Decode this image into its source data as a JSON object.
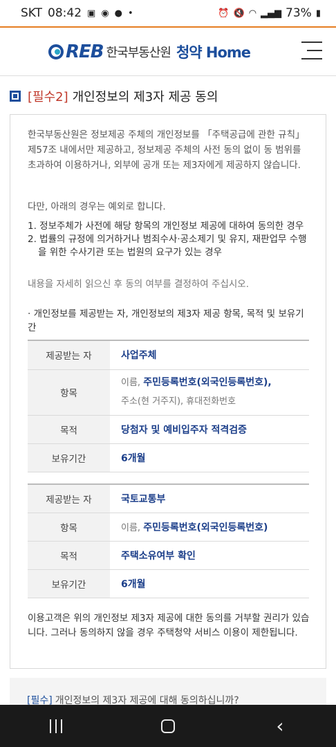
{
  "status_bar": {
    "carrier": "SKT",
    "time": "08:42",
    "battery": "73%"
  },
  "header": {
    "logo_reb": "REB",
    "logo_org": "한국부동산원",
    "logo_app_a": "청약",
    "logo_app_b": "Home"
  },
  "section": {
    "tag": "[필수2]",
    "title": "개인정보의 제3자 제공 동의"
  },
  "content": {
    "intro": "한국부동산원은 정보제공 주체의 개인정보를 「주택공급에 관한 규칙」 제57조 내에서만 제공하고, 정보제공 주체의 사전 동의 없이 동 범위를 초과하여 이용하거나, 외부에 공개 또는 제3자에게 제공하지 않습니다.",
    "exception_intro": "다만, 아래의 경우는 예외로 합니다.",
    "exceptions": [
      "1. 정보주체가 사전에 해당 항목의 개인정보 제공에 대하여 동의한 경우",
      "2. 법률의 규정에 의거하거나 범죄수사·공소제기 및 유지, 재판업무 수행을 위한 수사기관 또는 법원의 요구가 있는 경우"
    ],
    "notice": "내용을 자세히 읽으신 후 동의 여부를 결정하여 주십시오.",
    "table_heading": "· 개인정보를 제공받는 자, 개인정보의 제3자 제공 항목, 목적 및 보유기간",
    "table1": {
      "h_recipient": "제공받는 자",
      "recipient": "사업주체",
      "h_items": "항목",
      "items_a": "이름, ",
      "items_b": "주민등록번호(외국인등록번호),",
      "items_c": "주소(현 거주지), 휴대전화번호",
      "h_purpose": "목적",
      "purpose": "당첨자 및 예비입주자 적격검증",
      "h_period": "보유기간",
      "period": "6개월"
    },
    "table2": {
      "h_recipient": "제공받는 자",
      "recipient": "국토교통부",
      "h_items": "항목",
      "items_a": "이름, ",
      "items_b": "주민등록번호(외국인등록번호)",
      "h_purpose": "목적",
      "purpose": "주택소유여부 확인",
      "h_period": "보유기간",
      "period": "6개월"
    },
    "refusal": "이용고객은 위의 개인정보 제3자 제공에 대한 동의를 거부할 권리가 있습니다. 그러나 동의하지 않을 경우 주택청약 서비스 이용이 제한됩니다."
  },
  "agree": {
    "tag": "[필수]",
    "question": "개인정보의 제3자 제공에 대해 동의하십니까?"
  }
}
